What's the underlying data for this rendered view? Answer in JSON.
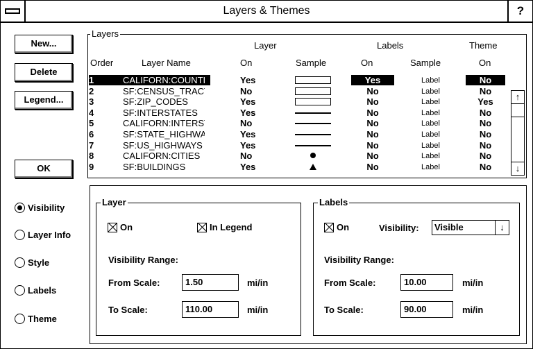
{
  "window": {
    "title": "Layers & Themes",
    "help_label": "?"
  },
  "buttons": {
    "new": "New...",
    "delete": "Delete",
    "legend": "Legend...",
    "ok": "OK"
  },
  "layers_group": {
    "label": "Layers",
    "headers": {
      "layer_group": "Layer",
      "labels_group": "Labels",
      "theme_group": "Theme",
      "order": "Order",
      "layer_name": "Layer Name",
      "layer_on": "On",
      "layer_sample": "Sample",
      "labels_on": "On",
      "labels_sample": "Sample",
      "theme_on": "On"
    },
    "rows": [
      {
        "order": "1",
        "name": "CALIFORN:COUNTIE",
        "on": "Yes",
        "sample": "box",
        "labels_on": "Yes",
        "label_sample": "Label",
        "theme_on": "No",
        "selected": true
      },
      {
        "order": "2",
        "name": "SF:CENSUS_TRACT:",
        "on": "No",
        "sample": "box",
        "labels_on": "No",
        "label_sample": "Label",
        "theme_on": "No"
      },
      {
        "order": "3",
        "name": "SF:ZIP_CODES",
        "on": "Yes",
        "sample": "box",
        "labels_on": "No",
        "label_sample": "Label",
        "theme_on": "Yes"
      },
      {
        "order": "4",
        "name": "SF:INTERSTATES",
        "on": "Yes",
        "sample": "line",
        "labels_on": "No",
        "label_sample": "Label",
        "theme_on": "No"
      },
      {
        "order": "5",
        "name": "CALIFORN:INTERST.",
        "on": "No",
        "sample": "line",
        "labels_on": "No",
        "label_sample": "Label",
        "theme_on": "No"
      },
      {
        "order": "6",
        "name": "SF:STATE_HIGHWA'",
        "on": "Yes",
        "sample": "line",
        "labels_on": "No",
        "label_sample": "Label",
        "theme_on": "No"
      },
      {
        "order": "7",
        "name": "SF:US_HIGHWAYS",
        "on": "Yes",
        "sample": "line",
        "labels_on": "No",
        "label_sample": "Label",
        "theme_on": "No"
      },
      {
        "order": "8",
        "name": "CALIFORN:CITIES",
        "on": "No",
        "sample": "dot",
        "labels_on": "No",
        "label_sample": "Label",
        "theme_on": "No"
      },
      {
        "order": "9",
        "name": "SF:BUILDINGS",
        "on": "Yes",
        "sample": "triangle",
        "labels_on": "No",
        "label_sample": "Label",
        "theme_on": "No"
      }
    ]
  },
  "scrollbar": {
    "up": "↑",
    "down": "↓"
  },
  "radio_options": [
    {
      "label": "Visibility",
      "selected": true
    },
    {
      "label": "Layer Info",
      "selected": false
    },
    {
      "label": "Style",
      "selected": false
    },
    {
      "label": "Labels",
      "selected": false
    },
    {
      "label": "Theme",
      "selected": false
    }
  ],
  "layer_panel": {
    "label": "Layer",
    "on_label": "On",
    "on_checked": true,
    "legend_label": "In Legend",
    "legend_checked": true,
    "range_label": "Visibility Range:",
    "from_label": "From Scale:",
    "from_value": "1.50",
    "from_unit": "mi/in",
    "to_label": "To Scale:",
    "to_value": "110.00",
    "to_unit": "mi/in"
  },
  "labels_panel": {
    "label": "Labels",
    "on_label": "On",
    "on_checked": true,
    "visibility_label": "Visibility:",
    "visibility_value": "Visible",
    "dropdown_arrow": "↓",
    "range_label": "Visibility Range:",
    "from_label": "From Scale:",
    "from_value": "10.00",
    "from_unit": "mi/in",
    "to_label": "To Scale:",
    "to_value": "90.00",
    "to_unit": "mi/in"
  }
}
